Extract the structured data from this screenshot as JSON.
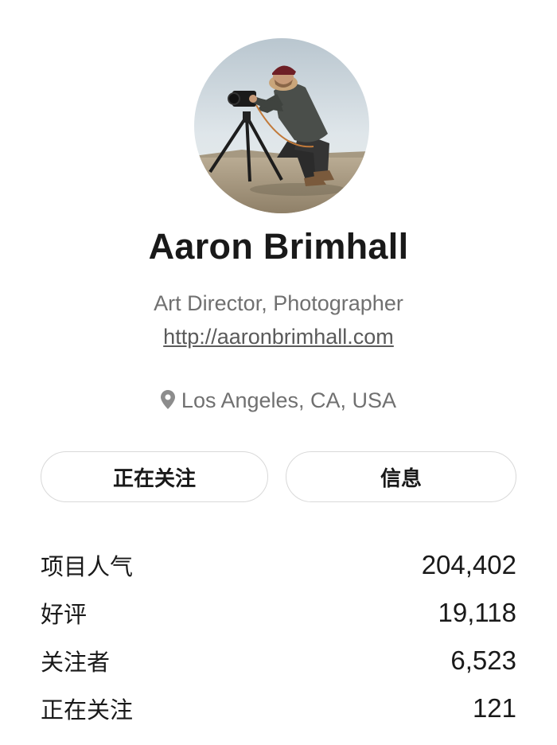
{
  "profile": {
    "name": "Aaron Brimhall",
    "occupation": "Art Director, Photographer",
    "website": "http://aaronbrimhall.com",
    "location": "Los Angeles, CA, USA",
    "avatar_icon": "profile-photo"
  },
  "actions": {
    "follow_label": "正在关注",
    "message_label": "信息"
  },
  "stats": [
    {
      "label": "项目人气",
      "value": "204,402"
    },
    {
      "label": "好评",
      "value": "19,118"
    },
    {
      "label": "关注者",
      "value": "6,523"
    },
    {
      "label": "正在关注",
      "value": "121"
    }
  ],
  "colors": {
    "text_primary": "#191919",
    "text_secondary": "#707070",
    "button_border": "#d9d9d9"
  }
}
